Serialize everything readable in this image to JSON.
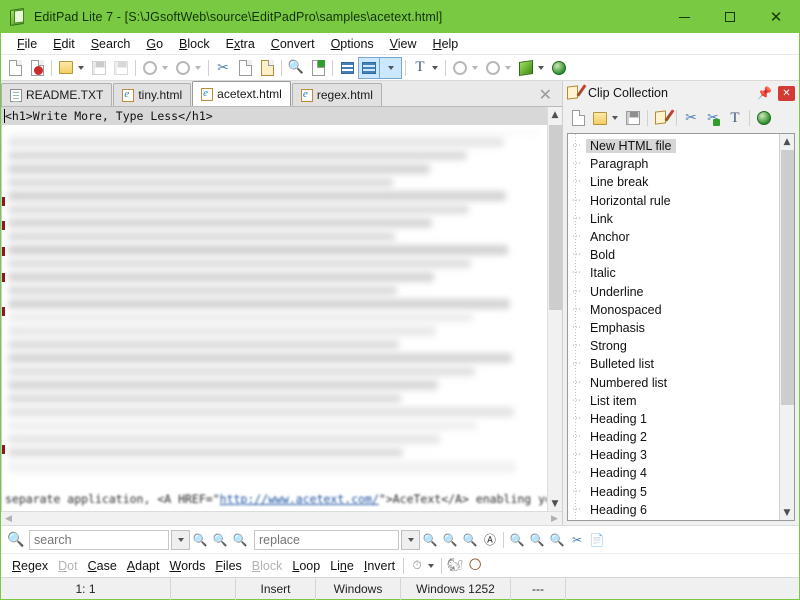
{
  "window": {
    "title": "EditPad Lite 7 - [S:\\JGsoftWeb\\source\\EditPadPro\\samples\\acetext.html]",
    "app_icon": "editpad-icon",
    "minimize": "minimize-icon",
    "maximize": "maximize-icon",
    "close": "close-icon",
    "titlebar_color": "#7ac943"
  },
  "menubar": {
    "items": [
      {
        "label": "File",
        "accel": "F"
      },
      {
        "label": "Edit",
        "accel": "E"
      },
      {
        "label": "Search",
        "accel": "S"
      },
      {
        "label": "Go",
        "accel": "G"
      },
      {
        "label": "Block",
        "accel": "B"
      },
      {
        "label": "Extra",
        "accel": "x"
      },
      {
        "label": "Convert",
        "accel": "C"
      },
      {
        "label": "Options",
        "accel": "O"
      },
      {
        "label": "View",
        "accel": "V"
      },
      {
        "label": "Help",
        "accel": "H"
      }
    ]
  },
  "toolbar": {
    "buttons": [
      {
        "name": "new-file-icon",
        "enabled": true
      },
      {
        "name": "close-file-icon",
        "enabled": true
      },
      {
        "name": "open-file-icon",
        "enabled": true,
        "dropdown": true
      },
      {
        "name": "save-file-icon",
        "enabled": false
      },
      {
        "name": "save-all-icon",
        "enabled": false
      },
      {
        "name": "undo-icon",
        "enabled": false,
        "dropdown": true
      },
      {
        "name": "redo-icon",
        "enabled": false,
        "dropdown": true
      },
      {
        "name": "cut-icon",
        "enabled": true
      },
      {
        "name": "copy-icon",
        "enabled": true
      },
      {
        "name": "paste-icon",
        "enabled": true
      },
      {
        "name": "find-icon",
        "enabled": true
      },
      {
        "name": "find-replace-icon",
        "enabled": true
      },
      {
        "name": "indent-icon",
        "enabled": true
      },
      {
        "name": "word-wrap-icon",
        "enabled": true,
        "selected": true,
        "dropdown": true
      },
      {
        "name": "font-icon",
        "enabled": true,
        "dropdown": true
      },
      {
        "name": "go-back-icon",
        "enabled": false,
        "dropdown": true
      },
      {
        "name": "go-forward-icon",
        "enabled": false,
        "dropdown": true
      },
      {
        "name": "book-icon",
        "enabled": true,
        "dropdown": true
      },
      {
        "name": "browse-icon",
        "enabled": true
      }
    ]
  },
  "file_tabs": {
    "tabs": [
      {
        "label": "README.TXT",
        "icon": "text-file-icon",
        "active": false
      },
      {
        "label": "tiny.html",
        "icon": "html-file-icon",
        "active": false
      },
      {
        "label": "acetext.html",
        "icon": "html-file-icon",
        "active": true
      },
      {
        "label": "regex.html",
        "icon": "html-file-icon",
        "active": false
      }
    ],
    "close_button": "close-tab-icon"
  },
  "editor": {
    "first_line": "<h1>Write More, Type Less</h1>",
    "last_line_prefix": "separate application, <A HREF=\"",
    "last_line_link": "http://www.acetext.com/",
    "last_line_suffix": "\">AceText</A> enabling you to",
    "vertical_scrollbar": {
      "up": "scroll-up-icon",
      "down": "scroll-down-icon"
    },
    "horizontal_scrollbar": {
      "left": "scroll-left-icon",
      "right": "scroll-right-icon"
    }
  },
  "clip_panel": {
    "title": "Clip Collection",
    "icon": "clip-collection-icon",
    "pin": "pin-icon",
    "close": "close-panel-icon",
    "toolbar": [
      {
        "name": "new-clip-icon"
      },
      {
        "name": "open-collection-icon",
        "dropdown": true
      },
      {
        "name": "save-collection-icon"
      },
      {
        "name": "edit-clip-icon"
      },
      {
        "name": "cut-clip-icon"
      },
      {
        "name": "add-clip-icon"
      },
      {
        "name": "paste-clip-icon"
      },
      {
        "name": "browse-clip-icon"
      }
    ],
    "items": [
      {
        "label": "New HTML file",
        "selected": true
      },
      {
        "label": "Paragraph",
        "selected": false
      },
      {
        "label": "Line break",
        "selected": false
      },
      {
        "label": "Horizontal rule",
        "selected": false
      },
      {
        "label": "Link",
        "selected": false
      },
      {
        "label": "Anchor",
        "selected": false
      },
      {
        "label": "Bold",
        "selected": false
      },
      {
        "label": "Italic",
        "selected": false
      },
      {
        "label": "Underline",
        "selected": false
      },
      {
        "label": "Monospaced",
        "selected": false
      },
      {
        "label": "Emphasis",
        "selected": false
      },
      {
        "label": "Strong",
        "selected": false
      },
      {
        "label": "Bulleted list",
        "selected": false
      },
      {
        "label": "Numbered list",
        "selected": false
      },
      {
        "label": "List item",
        "selected": false
      },
      {
        "label": "Heading 1",
        "selected": false
      },
      {
        "label": "Heading 2",
        "selected": false
      },
      {
        "label": "Heading 3",
        "selected": false
      },
      {
        "label": "Heading 4",
        "selected": false
      },
      {
        "label": "Heading 5",
        "selected": false
      },
      {
        "label": "Heading 6",
        "selected": false
      }
    ]
  },
  "search": {
    "search_icon": "search-icon",
    "search_value": "",
    "search_placeholder": "search",
    "replace_value": "",
    "replace_placeholder": "replace",
    "history_dropdown": "chevron-down-icon",
    "buttons": [
      {
        "name": "count-matches-icon"
      },
      {
        "name": "find-next-icon"
      },
      {
        "name": "find-previous-icon"
      },
      {
        "name": "replace-all-icon"
      },
      {
        "name": "replace-next-icon"
      },
      {
        "name": "replace-previous-icon"
      },
      {
        "name": "highlight-all-icon"
      },
      {
        "name": "find-in-files-icon"
      },
      {
        "name": "find-on-disk-icon"
      },
      {
        "name": "find-count-icon"
      },
      {
        "name": "cut-matches-icon"
      },
      {
        "name": "preview-icon"
      }
    ],
    "options": [
      {
        "label": "Regex",
        "accel": "R",
        "enabled": true
      },
      {
        "label": "Dot",
        "accel": "D",
        "enabled": false
      },
      {
        "label": "Case",
        "accel": "C",
        "enabled": true
      },
      {
        "label": "Adapt",
        "accel": "A",
        "enabled": true
      },
      {
        "label": "Words",
        "accel": "W",
        "enabled": true
      },
      {
        "label": "Files",
        "accel": "F",
        "enabled": true
      },
      {
        "label": "Block",
        "accel": "B",
        "enabled": false
      },
      {
        "label": "Loop",
        "accel": "L",
        "enabled": true
      },
      {
        "label": "Line",
        "accel": "n",
        "enabled": true
      },
      {
        "label": "Invert",
        "accel": "I",
        "enabled": true
      }
    ],
    "extra_icons": [
      {
        "name": "history-icon"
      },
      {
        "name": "dropdown-arrow-icon"
      },
      {
        "name": "cat-icon"
      },
      {
        "name": "feather-icon"
      }
    ]
  },
  "statusbar": {
    "cells": [
      {
        "name": "cursor-position",
        "value": "1: 1"
      },
      {
        "name": "selection-info",
        "value": ""
      },
      {
        "name": "insert-mode",
        "value": "Insert"
      },
      {
        "name": "line-break-style",
        "value": "Windows"
      },
      {
        "name": "encoding",
        "value": "Windows 1252"
      },
      {
        "name": "file-attributes",
        "value": "---"
      },
      {
        "name": "spare-cell",
        "value": ""
      }
    ]
  }
}
